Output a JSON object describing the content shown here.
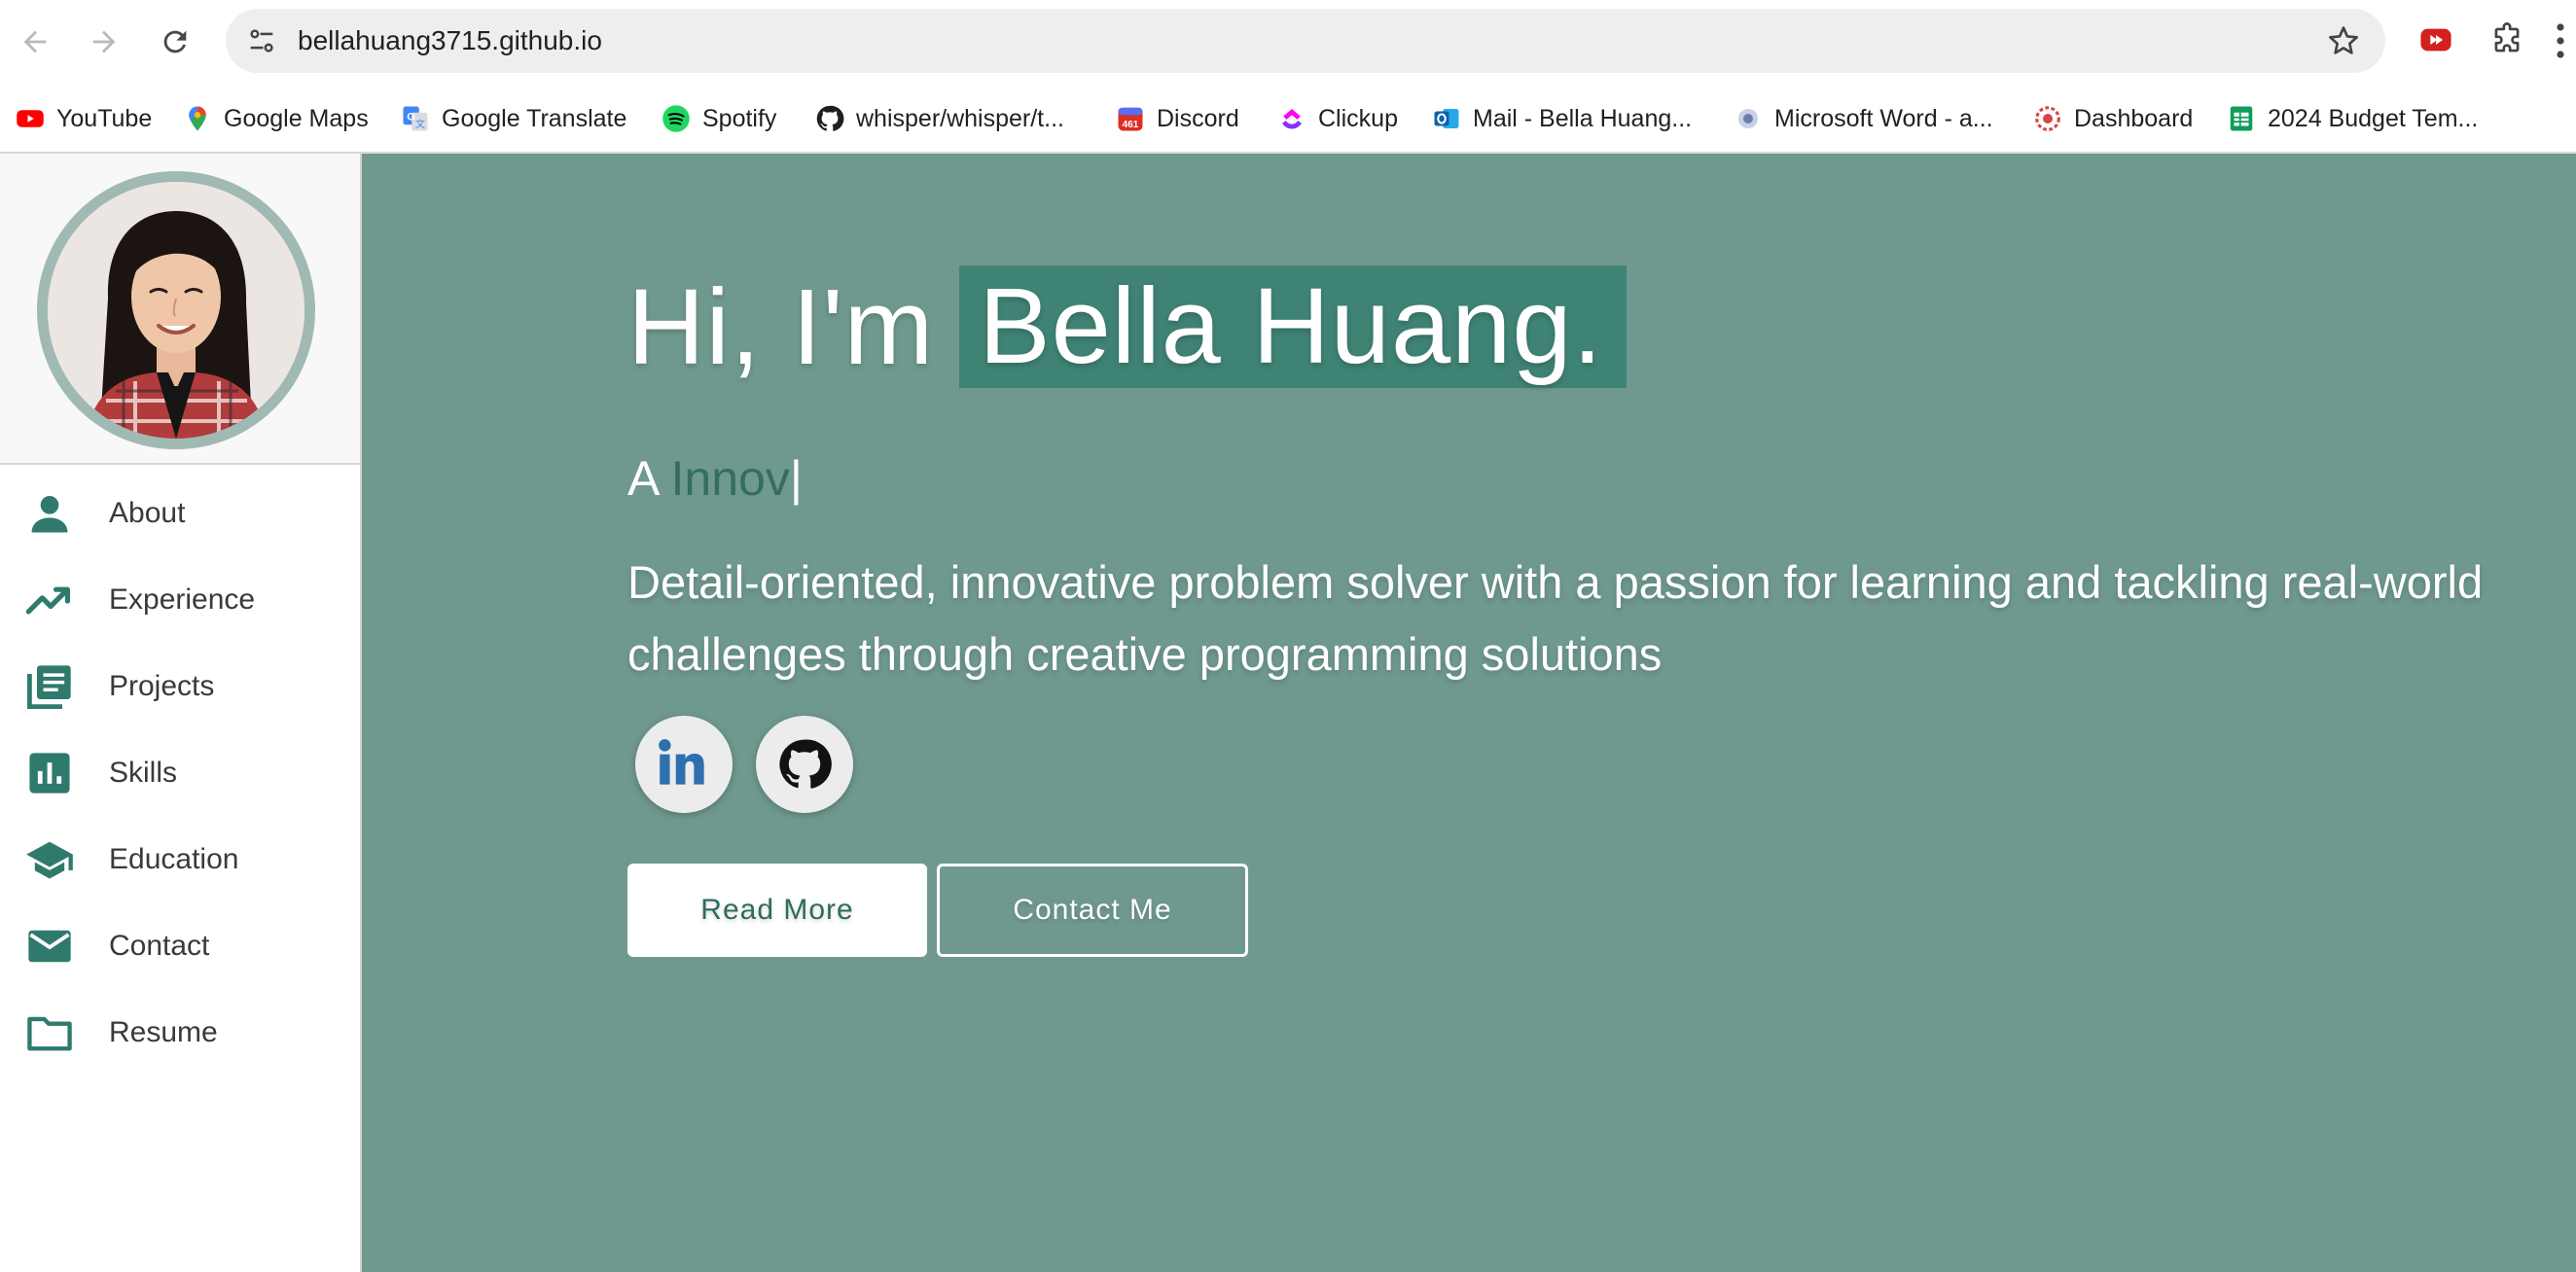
{
  "browser": {
    "url": "bellahuang3715.github.io",
    "bookmarks": [
      {
        "label": "YouTube",
        "icon": "youtube-icon"
      },
      {
        "label": "Google Maps",
        "icon": "google-maps-icon"
      },
      {
        "label": "Google Translate",
        "icon": "google-translate-icon"
      },
      {
        "label": "Spotify",
        "icon": "spotify-icon"
      },
      {
        "label": "whisper/whisper/t...",
        "icon": "github-icon"
      },
      {
        "label": "Discord",
        "icon": "calendar-icon"
      },
      {
        "label": "Clickup",
        "icon": "clickup-icon"
      },
      {
        "label": "Mail - Bella Huang...",
        "icon": "outlook-icon"
      },
      {
        "label": "Microsoft Word - a...",
        "icon": "word-icon"
      },
      {
        "label": "Dashboard",
        "icon": "dashboard-icon"
      },
      {
        "label": "2024 Budget Tem...",
        "icon": "sheets-icon"
      }
    ],
    "calendar_badge": "461"
  },
  "sidebar": {
    "items": [
      {
        "label": "About",
        "icon": "person-icon"
      },
      {
        "label": "Experience",
        "icon": "trending-up-icon"
      },
      {
        "label": "Projects",
        "icon": "library-books-icon"
      },
      {
        "label": "Skills",
        "icon": "bar-chart-icon"
      },
      {
        "label": "Education",
        "icon": "graduation-cap-icon"
      },
      {
        "label": "Contact",
        "icon": "mail-icon"
      },
      {
        "label": "Resume",
        "icon": "folder-icon"
      }
    ]
  },
  "hero": {
    "greeting": "Hi, I'm",
    "name": "Bella Huang.",
    "typed_prefix": "A",
    "typed_word": "Innov",
    "cursor": "|",
    "tagline": "Detail-oriented, innovative problem solver with a passion for learning and tackling real-world challenges through creative programming solutions",
    "social": [
      {
        "name": "linkedin",
        "label": "in"
      },
      {
        "name": "github"
      }
    ],
    "read_more": "Read More",
    "contact_me": "Contact Me"
  },
  "colors": {
    "hero_bg": "#6f998f",
    "accent": "#2f7a6c",
    "name_highlight": "#3f8375",
    "sidebar_icon": "#2f7a6c"
  }
}
